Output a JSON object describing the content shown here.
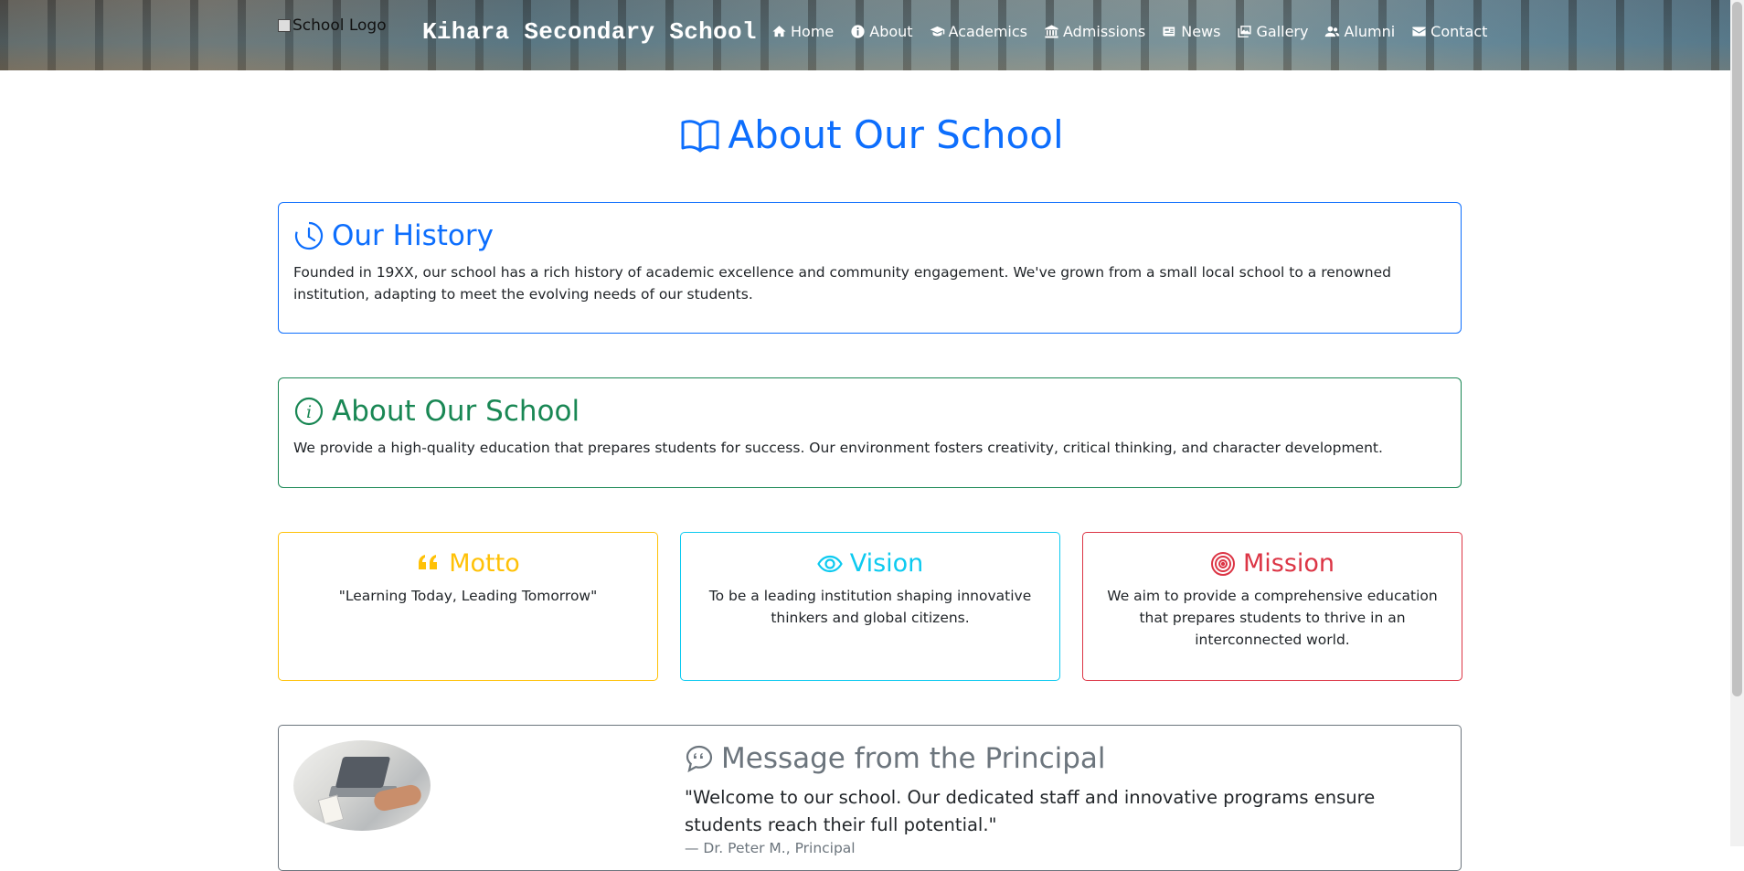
{
  "header": {
    "logo_alt": "School Logo",
    "brand": "Kihara Secondary School",
    "nav": [
      {
        "label": "Home",
        "icon": "home-icon"
      },
      {
        "label": "About",
        "icon": "info-icon"
      },
      {
        "label": "Academics",
        "icon": "graduation-cap-icon"
      },
      {
        "label": "Admissions",
        "icon": "university-icon"
      },
      {
        "label": "News",
        "icon": "newspaper-icon"
      },
      {
        "label": "Gallery",
        "icon": "images-icon"
      },
      {
        "label": "Alumni",
        "icon": "users-icon"
      },
      {
        "label": "Contact",
        "icon": "envelope-icon"
      }
    ]
  },
  "main": {
    "title": "About Our School",
    "history": {
      "title": "Our History",
      "text": "Founded in 19XX, our school has a rich history of academic excellence and community engagement. We've grown from a small local school to a renowned institution, adapting to meet the evolving needs of our students."
    },
    "about": {
      "title": "About Our School",
      "text": "We provide a high-quality education that prepares students for success. Our environment fosters creativity, critical thinking, and character development."
    },
    "motto": {
      "title": "Motto",
      "text": "\"Learning Today, Leading Tomorrow\""
    },
    "vision": {
      "title": "Vision",
      "text": "To be a leading institution shaping innovative thinkers and global citizens."
    },
    "mission": {
      "title": "Mission",
      "text": "We aim to provide a comprehensive education that prepares students to thrive in an interconnected world."
    },
    "principal": {
      "title": "Message from the Principal",
      "quote": "\"Welcome to our school. Our dedicated staff and innovative programs ensure students reach their full potential.\"",
      "signature": "— Dr. Peter M., Principal"
    }
  },
  "colors": {
    "primary": "#0d6efd",
    "success": "#198754",
    "warning": "#ffc107",
    "info": "#0dcaf0",
    "danger": "#dc3545",
    "secondary": "#6c757d"
  }
}
